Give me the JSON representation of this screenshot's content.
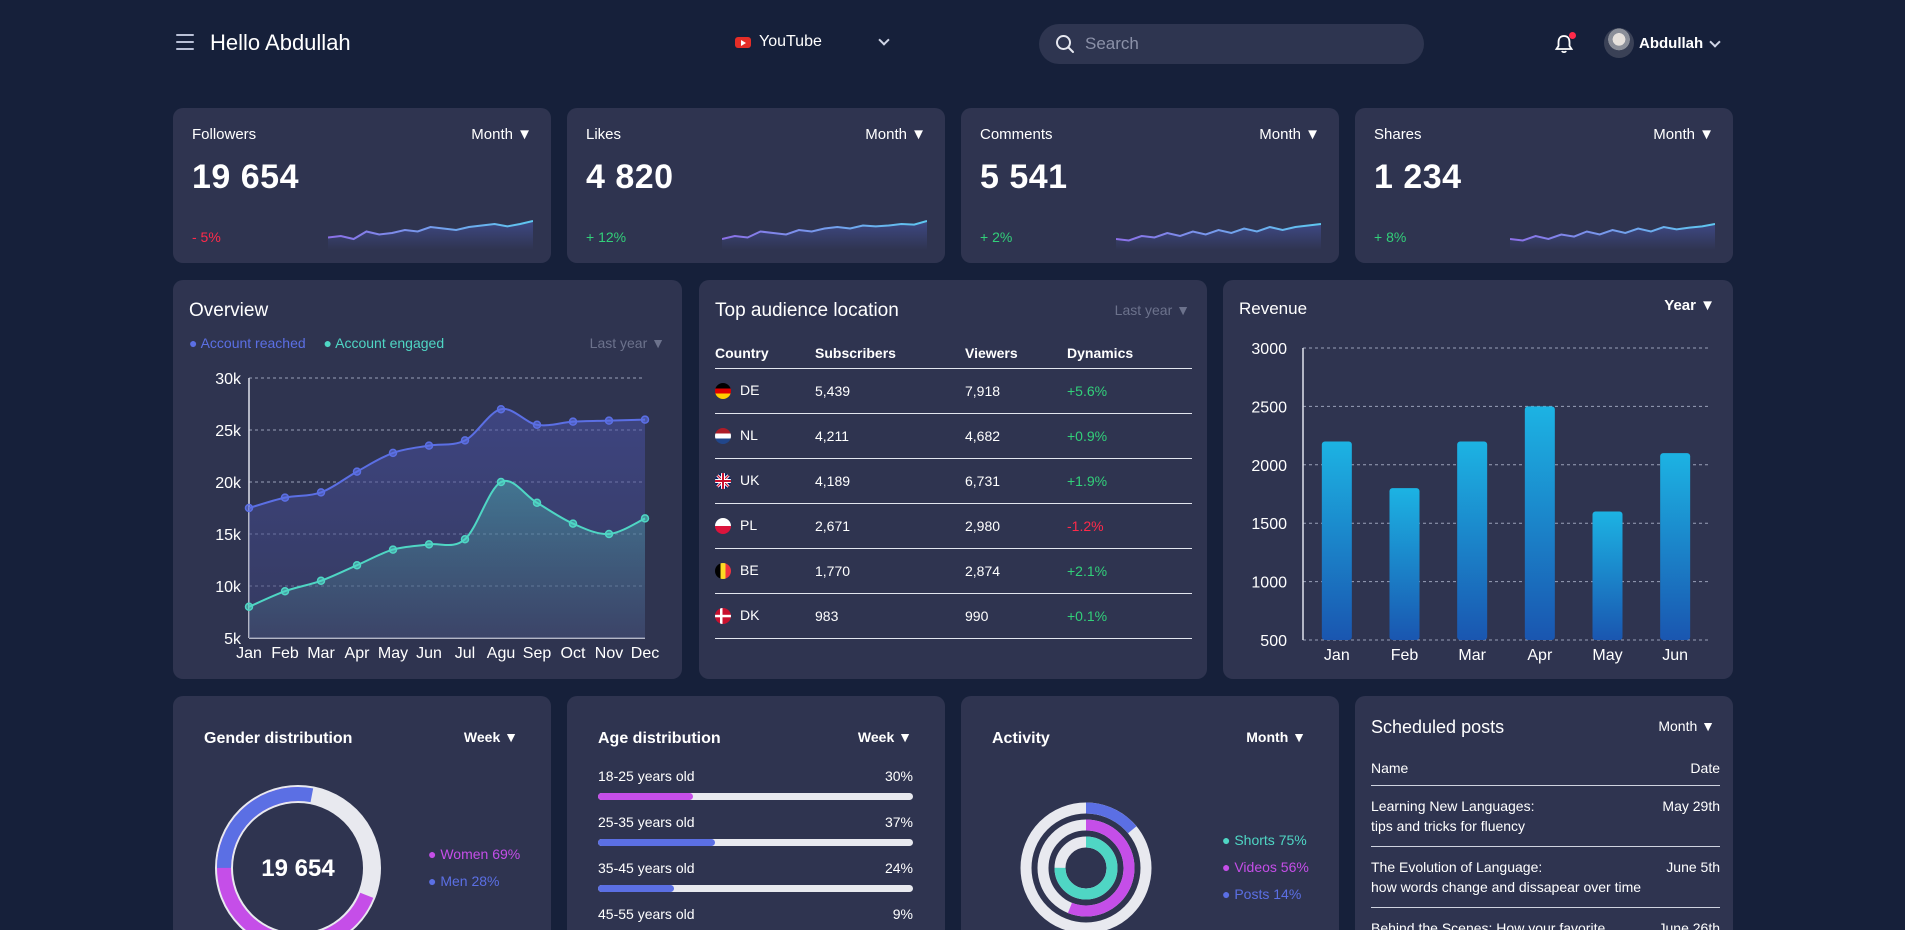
{
  "header": {
    "greeting": "Hello Abdullah",
    "platform": "YouTube",
    "search_placeholder": "Search",
    "user_name": "Abdullah"
  },
  "stats": [
    {
      "title": "Followers",
      "period": "Month ▼",
      "value": "19 654",
      "delta": "- 5%",
      "delta_color": "#ff2a4a"
    },
    {
      "title": "Likes",
      "period": "Month ▼",
      "value": "4 820",
      "delta": "+ 12%",
      "delta_color": "#32d07a"
    },
    {
      "title": "Comments",
      "period": "Month ▼",
      "value": "5 541",
      "delta": "+ 2%",
      "delta_color": "#32d07a"
    },
    {
      "title": "Shares",
      "period": "Month ▼",
      "value": "1 234",
      "delta": "+ 8%",
      "delta_color": "#32d07a"
    }
  ],
  "overview": {
    "title": "Overview",
    "legend_reached": "● Account reached",
    "legend_engaged": "● Account engaged",
    "period": "Last year ▼"
  },
  "location": {
    "title": "Top audience location",
    "period": "Last year ▼",
    "columns": [
      "Country",
      "Subscribers",
      "Viewers",
      "Dynamics"
    ],
    "rows": [
      {
        "country": "DE",
        "subscribers": "5,439",
        "viewers": "7,918",
        "dynamics": "+5.6%",
        "color": "#32d07a"
      },
      {
        "country": "NL",
        "subscribers": "4,211",
        "viewers": "4,682",
        "dynamics": "+0.9%",
        "color": "#32d07a"
      },
      {
        "country": "UK",
        "subscribers": "4,189",
        "viewers": "6,731",
        "dynamics": "+1.9%",
        "color": "#32d07a"
      },
      {
        "country": "PL",
        "subscribers": "2,671",
        "viewers": "2,980",
        "dynamics": "-1.2%",
        "color": "#ff2a4a"
      },
      {
        "country": "BE",
        "subscribers": "1,770",
        "viewers": "2,874",
        "dynamics": "+2.1%",
        "color": "#32d07a"
      },
      {
        "country": "DK",
        "subscribers": "983",
        "viewers": "990",
        "dynamics": "+0.1%",
        "color": "#32d07a"
      }
    ]
  },
  "revenue": {
    "title": "Revenue",
    "period": "Year ▼"
  },
  "gender": {
    "title": "Gender distribution",
    "period": "Week ▼",
    "center": "19 654",
    "women": "● Women 69%",
    "men": "● Men 28%"
  },
  "age": {
    "title": "Age distribution",
    "period": "Week ▼",
    "rows": [
      {
        "label": "18-25 years old",
        "pct": "30%",
        "value": 0.3,
        "color": "#c54ee8"
      },
      {
        "label": "25-35 years old",
        "pct": "37%",
        "value": 0.37,
        "color": "#5b6fe4"
      },
      {
        "label": "35-45 years old",
        "pct": "24%",
        "value": 0.24,
        "color": "#5b6fe4"
      },
      {
        "label": "45-55 years old",
        "pct": "9%",
        "value": 0.09,
        "color": "#5b6fe4"
      }
    ]
  },
  "activity": {
    "title": "Activity",
    "period": "Month ▼",
    "shorts": "● Shorts 75%",
    "videos": "● Videos 56%",
    "posts": "● Posts 14%"
  },
  "scheduled": {
    "title": "Scheduled posts",
    "period": "Month ▼",
    "col_name": "Name",
    "col_date": "Date",
    "posts": [
      {
        "line1": "Learning New Languages:",
        "line2": "tips and tricks for fluency",
        "date": "May 29th"
      },
      {
        "line1": "The Evolution of Language:",
        "line2": "how words change and dissapear over time",
        "date": "June 5th"
      },
      {
        "line1": "Behind the Scenes: How your favorite",
        "line2": "",
        "date": "June 26th"
      }
    ]
  },
  "chart_data": [
    {
      "type": "line",
      "title": "Overview",
      "categories": [
        "Jan",
        "Feb",
        "Mar",
        "Apr",
        "May",
        "Jun",
        "Jul",
        "Agu",
        "Sep",
        "Oct",
        "Nov",
        "Dec"
      ],
      "series": [
        {
          "name": "Account reached",
          "values": [
            17500,
            18500,
            19000,
            21000,
            22800,
            23500,
            24000,
            27000,
            25500,
            25800,
            25900,
            26000
          ]
        },
        {
          "name": "Account engaged",
          "values": [
            8000,
            9500,
            10500,
            12000,
            13500,
            14000,
            14500,
            20000,
            18000,
            16000,
            15000,
            16500
          ]
        }
      ],
      "yticks": [
        "5k",
        "10k",
        "15k",
        "20k",
        "25k",
        "30k"
      ],
      "ylim": [
        5000,
        30000
      ]
    },
    {
      "type": "bar",
      "title": "Revenue",
      "categories": [
        "Jan",
        "Feb",
        "Mar",
        "Apr",
        "May",
        "Jun"
      ],
      "values": [
        2200,
        1800,
        2200,
        2500,
        1600,
        2100
      ],
      "yticks": [
        "500",
        "1000",
        "1500",
        "2000",
        "2500",
        "3000"
      ],
      "ylim": [
        500,
        3000
      ]
    },
    {
      "type": "pie",
      "title": "Gender distribution",
      "categories": [
        "Women",
        "Men"
      ],
      "values": [
        69,
        28
      ]
    },
    {
      "type": "pie",
      "title": "Activity",
      "categories": [
        "Shorts",
        "Videos",
        "Posts"
      ],
      "values": [
        75,
        56,
        14
      ]
    }
  ],
  "colors": {
    "accent_blue": "#5b6fe4",
    "accent_teal": "#4fd6c4",
    "accent_pink": "#c54ee8",
    "positive": "#32d07a",
    "negative": "#ff2a4a"
  }
}
